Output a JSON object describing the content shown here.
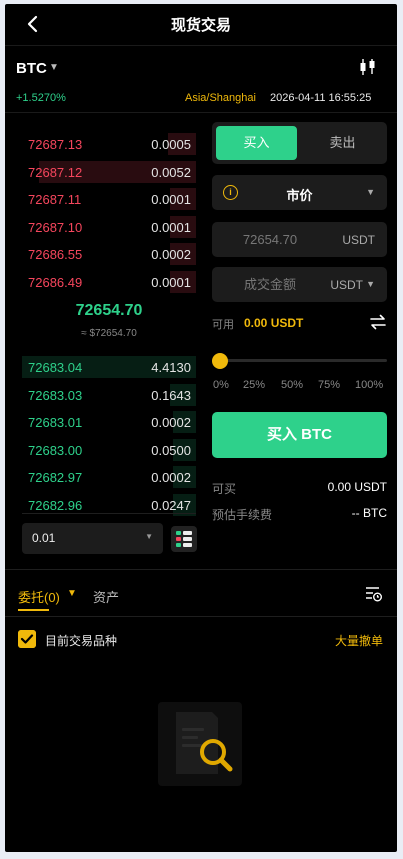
{
  "header": {
    "title": "现货交易"
  },
  "symbol": {
    "name": "BTC",
    "change": "+1.5270%",
    "timezone": "Asia/Shanghai",
    "datetime": "2026-04-11 16:55:25"
  },
  "order_book": {
    "asks": [
      {
        "price": "72687.13",
        "qty": "0.0005",
        "depth": 0.16
      },
      {
        "price": "72687.12",
        "qty": "0.0052",
        "depth": 0.9
      },
      {
        "price": "72687.11",
        "qty": "0.0001",
        "depth": 0.15
      },
      {
        "price": "72687.10",
        "qty": "0.0001",
        "depth": 0.15
      },
      {
        "price": "72686.55",
        "qty": "0.0002",
        "depth": 0.15
      },
      {
        "price": "72686.49",
        "qty": "0.0001",
        "depth": 0.15
      }
    ],
    "mid_price": "72654.70",
    "mid_ref": "≈ $72654.70",
    "bids": [
      {
        "price": "72683.04",
        "qty": "4.4130",
        "depth": 1.0
      },
      {
        "price": "72683.03",
        "qty": "0.1643",
        "depth": 0.15
      },
      {
        "price": "72683.01",
        "qty": "0.0002",
        "depth": 0.13
      },
      {
        "price": "72683.00",
        "qty": "0.0500",
        "depth": 0.13
      },
      {
        "price": "72682.97",
        "qty": "0.0002",
        "depth": 0.13
      },
      {
        "price": "72682.96",
        "qty": "0.0247",
        "depth": 0.13
      }
    ],
    "precision": "0.01"
  },
  "form": {
    "buy_tab": "买入",
    "sell_tab": "卖出",
    "order_type": "市价",
    "price_placeholder": "72654.70",
    "price_unit": "USDT",
    "amount_placeholder": "成交金额",
    "amount_unit": "USDT",
    "available_label": "可用",
    "available_value": "0.00 USDT",
    "slider_value": 0,
    "slider_marks": [
      "0%",
      "25%",
      "50%",
      "75%",
      "100%"
    ],
    "buy_button": "买入 BTC",
    "can_buy_label": "可买",
    "can_buy_value": "0.00 USDT",
    "fee_label": "预估手续费",
    "fee_value": "-- BTC"
  },
  "bottom": {
    "orders_tab": "委托(0)",
    "assets_tab": "资产",
    "current_pair_label": "目前交易品种",
    "cancel_all": "大量撤单"
  },
  "colors": {
    "buy": "#2ed18b",
    "sell": "#f6465d",
    "accent": "#f0b90b"
  }
}
